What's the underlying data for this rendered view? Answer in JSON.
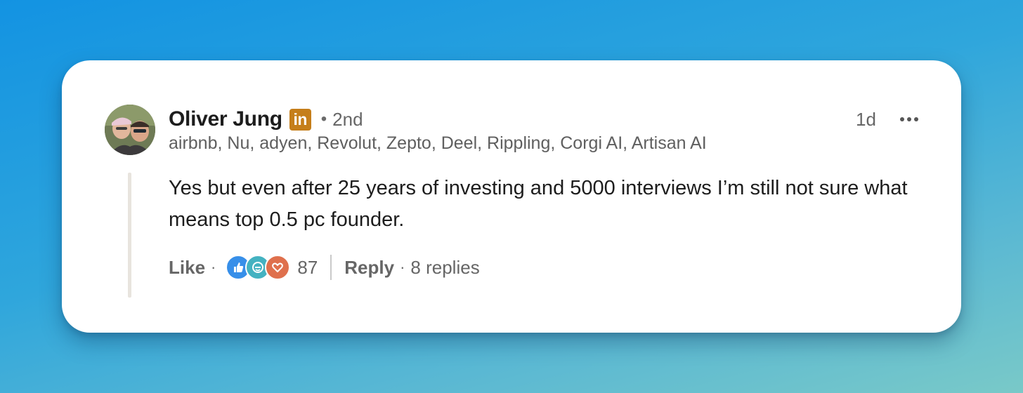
{
  "comment": {
    "author": {
      "name": "Oliver Jung",
      "badge": "in",
      "degree": "2nd",
      "headline": "airbnb, Nu, adyen, Revolut, Zepto, Deel, Rippling, Corgi AI, Artisan AI"
    },
    "timestamp": "1d",
    "separator": "•",
    "text": "Yes but even after 25 years of investing and 5000 interviews I’m still not sure what means top 0.5 pc founder.",
    "actions": {
      "like_label": "Like",
      "dot": "·",
      "reaction_icons": [
        "like-reaction-icon",
        "celebrate-reaction-icon",
        "love-reaction-icon"
      ],
      "reaction_count": "87",
      "reply_label": "Reply",
      "replies_label": "8 replies"
    }
  },
  "colors": {
    "badge": "#c57e1a",
    "like_reaction": "#378fe9",
    "celebrate_reaction": "#44b2c1",
    "love_reaction": "#df704d",
    "thread_line": "#e8e4de"
  }
}
